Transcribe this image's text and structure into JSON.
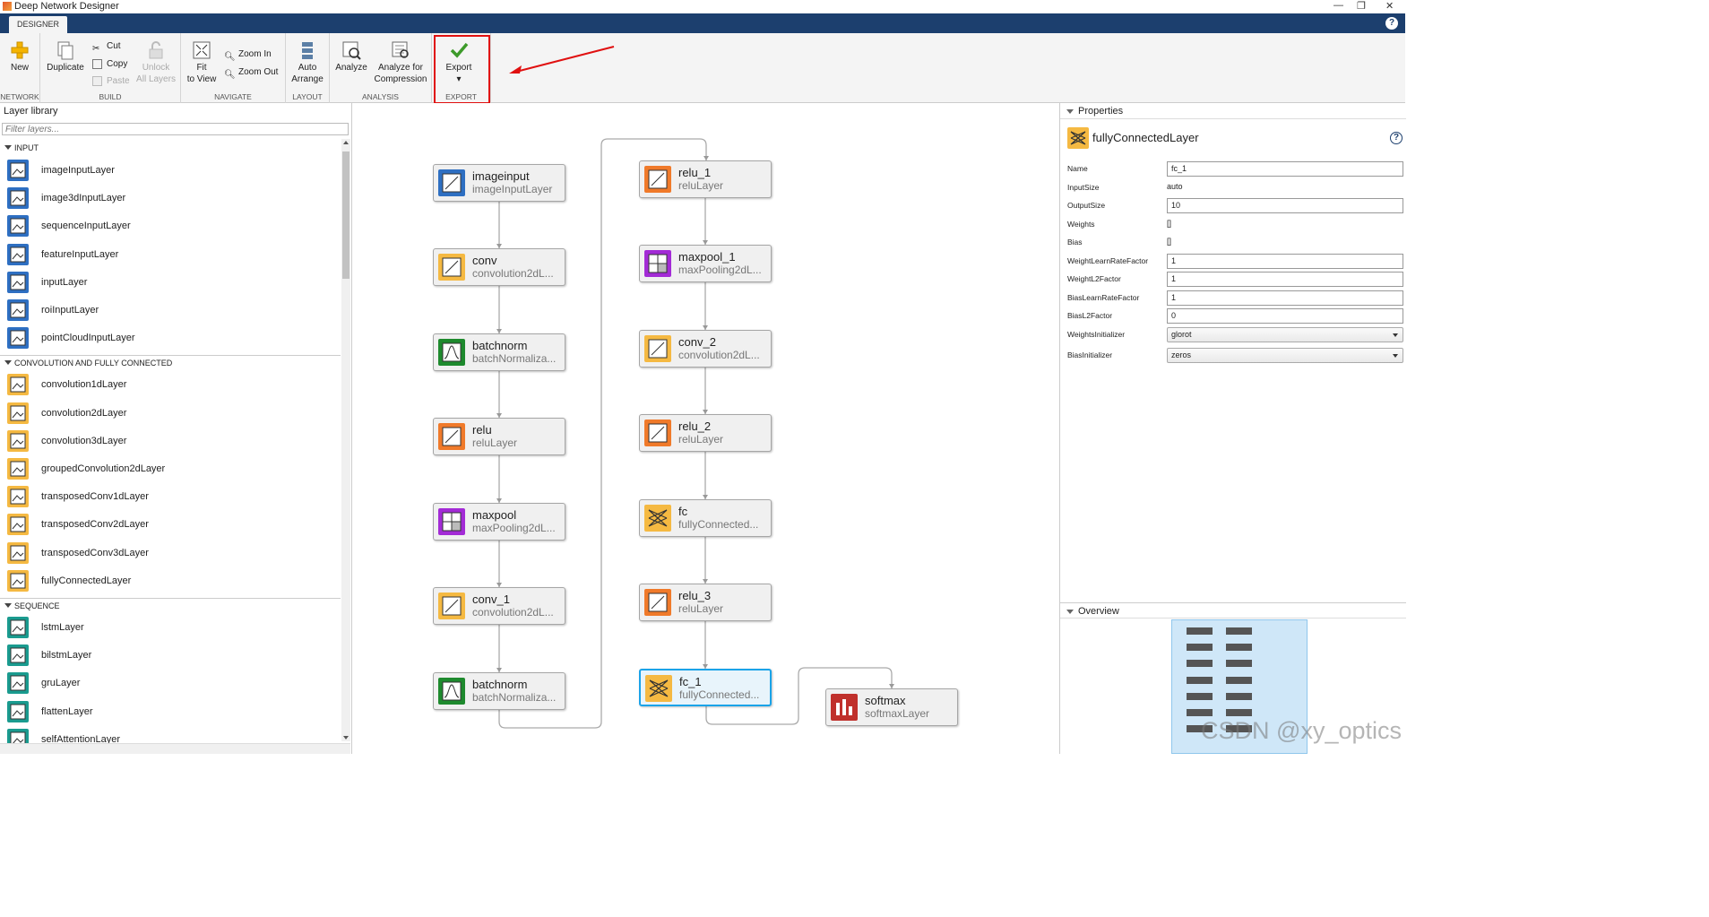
{
  "window": {
    "title": "Deep Network Designer"
  },
  "tabs": [
    "DESIGNER"
  ],
  "ribbon": {
    "network": {
      "caption": "NETWORK",
      "new": "New"
    },
    "build": {
      "caption": "BUILD",
      "duplicate": "Duplicate",
      "cut": "Cut",
      "copy": "Copy",
      "paste": "Paste",
      "unlock1": "Unlock",
      "unlock2": "All Layers"
    },
    "navigate": {
      "caption": "NAVIGATE",
      "fit1": "Fit",
      "fit2": "to View",
      "zoom_in": "Zoom In",
      "zoom_out": "Zoom Out"
    },
    "layout": {
      "caption": "LAYOUT",
      "auto1": "Auto",
      "auto2": "Arrange"
    },
    "analysis": {
      "caption": "ANALYSIS",
      "analyze": "Analyze",
      "comp1": "Analyze for",
      "comp2": "Compression"
    },
    "export": {
      "caption": "EXPORT",
      "export": "Export"
    }
  },
  "library": {
    "title": "Layer library",
    "filter_placeholder": "Filter layers...",
    "categories": [
      {
        "name": "INPUT",
        "items": [
          "imageInputLayer",
          "image3dInputLayer",
          "sequenceInputLayer",
          "featureInputLayer",
          "inputLayer",
          "roiInputLayer",
          "pointCloudInputLayer"
        ]
      },
      {
        "name": "CONVOLUTION AND FULLY CONNECTED",
        "items": [
          "convolution1dLayer",
          "convolution2dLayer",
          "convolution3dLayer",
          "groupedConvolution2dLayer",
          "transposedConv1dLayer",
          "transposedConv2dLayer",
          "transposedConv3dLayer",
          "fullyConnectedLayer"
        ]
      },
      {
        "name": "SEQUENCE",
        "items": [
          "lstmLayer",
          "bilstmLayer",
          "gruLayer",
          "flattenLayer",
          "selfAttentionLayer"
        ]
      }
    ]
  },
  "network": {
    "nodes": [
      {
        "name": "imageinput",
        "type": "imageInputLayer"
      },
      {
        "name": "conv",
        "type": "convolution2dL..."
      },
      {
        "name": "batchnorm",
        "type": "batchNormaliza..."
      },
      {
        "name": "relu",
        "type": "reluLayer"
      },
      {
        "name": "maxpool",
        "type": "maxPooling2dL..."
      },
      {
        "name": "conv_1",
        "type": "convolution2dL..."
      },
      {
        "name": "batchnorm",
        "type": "batchNormaliza..."
      },
      {
        "name": "relu_1",
        "type": "reluLayer"
      },
      {
        "name": "maxpool_1",
        "type": "maxPooling2dL..."
      },
      {
        "name": "conv_2",
        "type": "convolution2dL..."
      },
      {
        "name": "relu_2",
        "type": "reluLayer"
      },
      {
        "name": "fc",
        "type": "fullyConnected..."
      },
      {
        "name": "relu_3",
        "type": "reluLayer"
      },
      {
        "name": "fc_1",
        "type": "fullyConnected..."
      },
      {
        "name": "softmax",
        "type": "softmaxLayer"
      }
    ],
    "selected": "fc_1"
  },
  "properties": {
    "header": "Properties",
    "layer_type": "fullyConnectedLayer",
    "rows": [
      {
        "label": "Name",
        "value": "fc_1",
        "kind": "input"
      },
      {
        "label": "InputSize",
        "value": "auto",
        "kind": "text"
      },
      {
        "label": "OutputSize",
        "value": "10",
        "kind": "input"
      },
      {
        "label": "Weights",
        "value": "[]",
        "kind": "text"
      },
      {
        "label": "Bias",
        "value": "[]",
        "kind": "text"
      },
      {
        "label": "WeightLearnRateFactor",
        "value": "1",
        "kind": "input"
      },
      {
        "label": "WeightL2Factor",
        "value": "1",
        "kind": "input"
      },
      {
        "label": "BiasLearnRateFactor",
        "value": "1",
        "kind": "input"
      },
      {
        "label": "BiasL2Factor",
        "value": "0",
        "kind": "input"
      },
      {
        "label": "WeightsInitializer",
        "value": "glorot",
        "kind": "select"
      },
      {
        "label": "BiasInitializer",
        "value": "zeros",
        "kind": "select"
      }
    ]
  },
  "overview": {
    "header": "Overview"
  },
  "watermark": "CSDN @xy_optics",
  "colors": {
    "accent": "#1c3f6e",
    "selection": "#1aa3e8",
    "highlight": "#e01010"
  }
}
